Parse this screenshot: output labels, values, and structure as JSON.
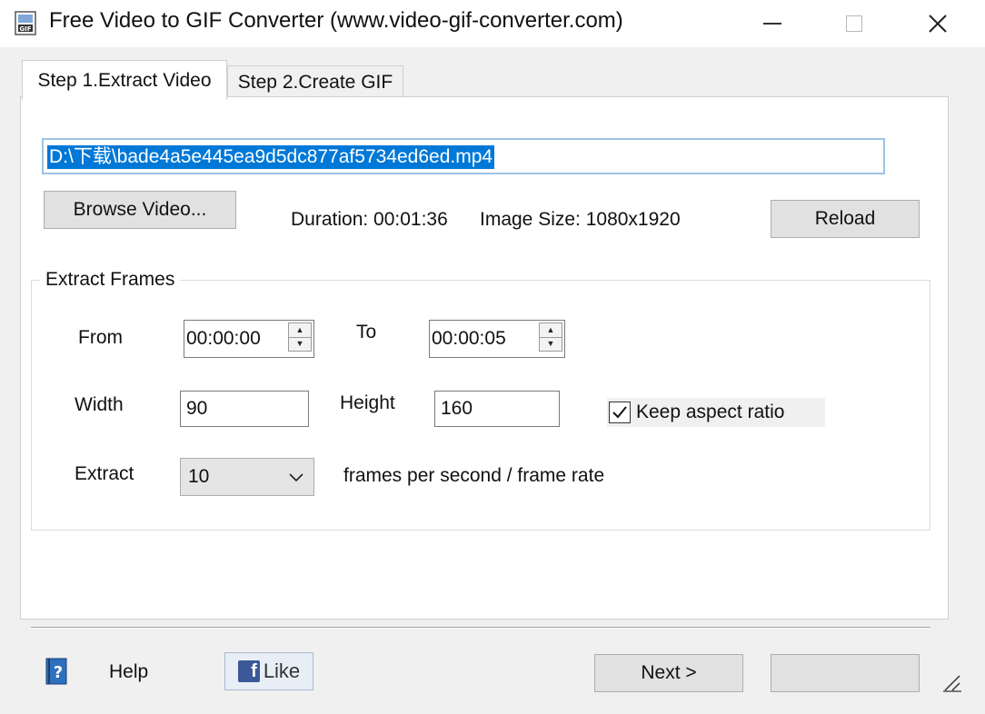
{
  "window": {
    "title": "Free Video to GIF Converter (www.video-gif-converter.com)",
    "icon": "gif-app-icon",
    "controls": [
      "minimize-icon",
      "maximize-icon",
      "close-icon"
    ]
  },
  "tabs": [
    {
      "label": "Step 1.Extract Video",
      "active": true
    },
    {
      "label": "Step 2.Create GIF",
      "active": false
    }
  ],
  "video": {
    "path": "D:\\下载\\bade4a5e445ea9d5dc877af5734ed6ed.mp4",
    "browse_label": "Browse Video...",
    "duration": "Duration: 00:01:36",
    "image_size": "Image Size:  1080x1920",
    "reload_label": "Reload"
  },
  "extract_frames": {
    "group_title": "Extract Frames",
    "from_label": "From",
    "from_value": "00:00:00",
    "to_label": "To",
    "to_value": "00:00:05",
    "width_label": "Width",
    "width_value": "90",
    "height_label": "Height",
    "height_value": "160",
    "keep_aspect_label": "Keep aspect ratio",
    "keep_aspect_checked": true,
    "extract_label": "Extract",
    "fps_value": "10",
    "fps_suffix": "frames per second / frame rate"
  },
  "footer": {
    "help_label": "Help",
    "like_label": "Like",
    "next_label": "Next >",
    "second_button_label": ""
  },
  "colors": {
    "selection": "#0078d7",
    "facebook": "#3b5998",
    "button_face": "#e1e1e1",
    "window_bg": "#f0f0f0"
  }
}
